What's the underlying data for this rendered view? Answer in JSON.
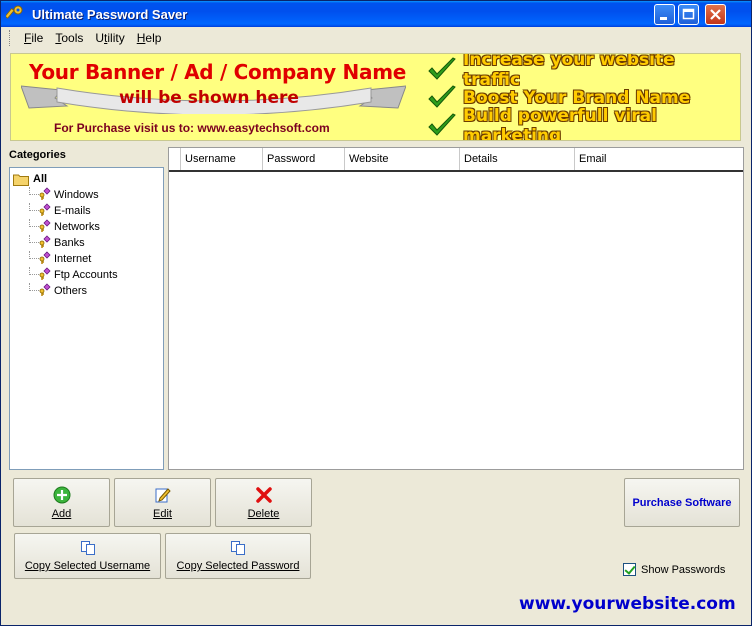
{
  "window": {
    "title": "Ultimate Password Saver",
    "controls": [
      "minimize",
      "maximize",
      "close"
    ]
  },
  "menu": {
    "items": [
      {
        "prefix": "",
        "accel": "F",
        "rest": "ile"
      },
      {
        "prefix": "",
        "accel": "T",
        "rest": "ools"
      },
      {
        "prefix": "",
        "accel": "U",
        "rest": "tility"
      },
      {
        "prefix": "",
        "accel": "H",
        "rest": "elp"
      }
    ]
  },
  "banner": {
    "line1": "Your Banner / Ad / Company Name",
    "line2": "will be shown here",
    "line3": "For Purchase visit us to: www.easytechsoft.com",
    "bullets": [
      "Increase your website traffic",
      "Boost Your Brand Name",
      "Build powerfull viral marketing"
    ],
    "colors": {
      "background": "#ffff80",
      "headline": "#e00000",
      "bullet_text": "#ffcc00",
      "check": "#2e9d1c"
    }
  },
  "categories": {
    "label": "Categories",
    "root": "All",
    "items": [
      "Windows",
      "E-mails",
      "Networks",
      "Banks",
      "Internet",
      "Ftp Accounts",
      "Others"
    ]
  },
  "grid": {
    "columns": [
      "Username",
      "Password",
      "Website",
      "Details",
      "Email"
    ],
    "rows": []
  },
  "buttons": {
    "add": "Add",
    "edit": "Edit",
    "delete": "Delete",
    "copy_username": "Copy Selected Username",
    "copy_password": "Copy Selected Password",
    "purchase": "Purchase Software"
  },
  "options": {
    "show_passwords_label": "Show Passwords",
    "show_passwords_checked": true
  },
  "footer": {
    "website": "www.yourwebsite.com"
  }
}
